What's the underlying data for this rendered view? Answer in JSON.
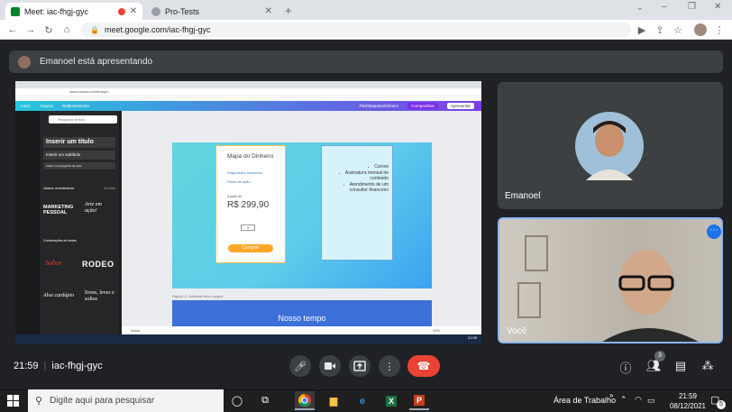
{
  "browser": {
    "tabs": [
      {
        "title": "Meet: iac-fhgj-gyc",
        "active": true
      },
      {
        "title": "Pro-Tests",
        "active": false
      }
    ],
    "new_tab": "+",
    "url": "meet.google.com/iac-fhgj-gyc"
  },
  "meet": {
    "presenting_text": "Emanoel está apresentando",
    "participants": [
      {
        "name": "Emanoel"
      },
      {
        "name": "Você"
      }
    ],
    "time": "21:59",
    "separator": "|",
    "meeting_code": "iac-fhgj-gyc",
    "people_count": "3"
  },
  "shared_screen": {
    "canva": {
      "menu": [
        "Início",
        "Arquivo",
        "Redimensionar"
      ],
      "project": "PitchMapaDoDinheiro",
      "share": "Compartilhar",
      "present": "Apresentar",
      "search": "Pesquisar textos",
      "heading_add": "Inserir um título",
      "subtitle_add": "Inserir um subtítulo",
      "body_add": "Inserir um pouquinho de texto",
      "recent": "Usados recentemente",
      "see_all": "Ver tudo",
      "fonts_combo": "Combinações de fontes",
      "font_samples": [
        "MARKETING PESSOAL",
        "Arte em ação!",
        "Sabor",
        "RODEO",
        "Aloe cardápio",
        "livres, leves e soltos"
      ],
      "page_label": "Página 13 - Adicionar título à página",
      "next_page_title": "Nosso tempo",
      "card1": {
        "title": "Mapa do Dinheiro",
        "items": [
          "Diagnóstico financeiro",
          "Plano de ação"
        ],
        "price_label": "A partir de",
        "price": "R$ 299,90",
        "qty": "1",
        "buy": "Comprar"
      },
      "card2": {
        "items": [
          "Cursos",
          "Assinatura mensal de conteúdo",
          "Atendimento de um consultor financeiro"
        ]
      },
      "notes": "Notas",
      "zoom": "33%",
      "clock": "21:59"
    }
  },
  "windows": {
    "search_placeholder": "Digite aqui para pesquisar",
    "tray_label": "Área de Trabalho",
    "clock_time": "21:59",
    "clock_date": "08/12/2021",
    "notif_count": "5"
  },
  "colors": {
    "meet_bg": "#202124",
    "end_call": "#ea4335",
    "accent": "#8ab4f8",
    "canva_gradient_start": "#24c6dc",
    "canva_gradient_end": "#7b3fe4"
  }
}
